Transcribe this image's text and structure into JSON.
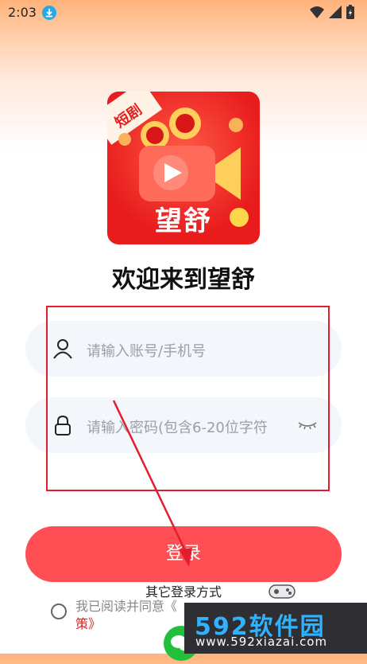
{
  "status_bar": {
    "time": "2:03"
  },
  "logo": {
    "tag": "短剧",
    "brand": "望舒"
  },
  "welcome_title": "欢迎来到望舒",
  "account_field": {
    "placeholder": "请输入账号/手机号"
  },
  "password_field": {
    "placeholder": "请输入密码(包含6-20位字符"
  },
  "login_button": "登录",
  "other_login_label": "其它登录方式",
  "agreement": {
    "text": "我已阅读并同意《",
    "link": "策》"
  },
  "watermark": {
    "logo": "592软件园",
    "site": "www.592xiazai.com"
  },
  "colors": {
    "accent": "#ff4f54",
    "highlight_box": "#e21e2e",
    "watermark_blue": "#2fb3ff"
  }
}
